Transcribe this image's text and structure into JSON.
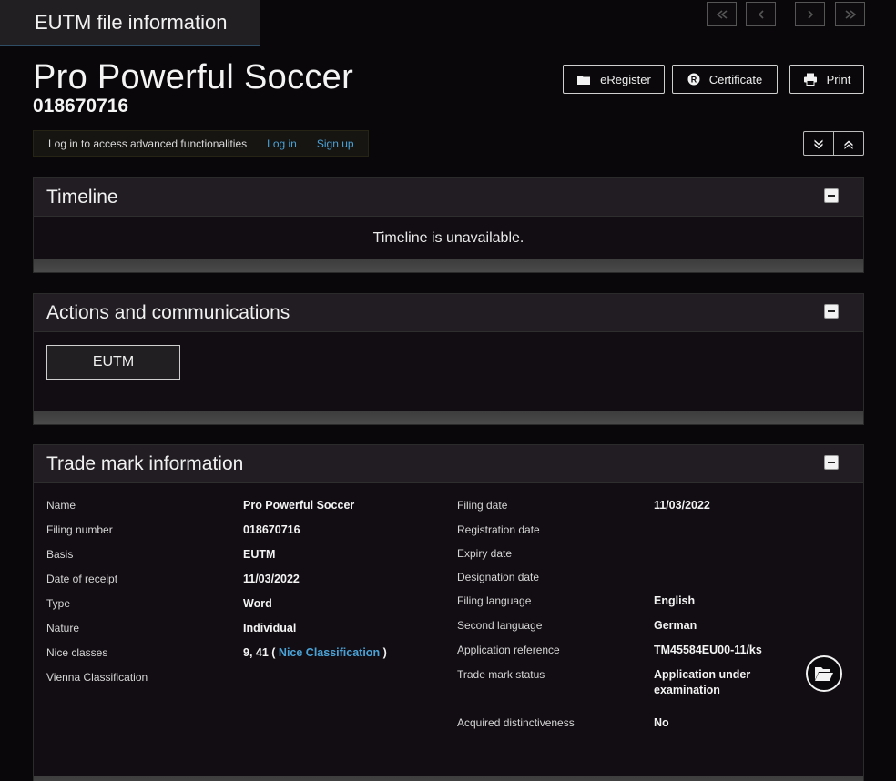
{
  "header": {
    "tab_title": "EUTM file information"
  },
  "trademark": {
    "title": "Pro Powerful Soccer",
    "file_number": "018670716"
  },
  "toolbar": {
    "eregister_label": "eRegister",
    "certificate_label": "Certificate",
    "print_label": "Print"
  },
  "login": {
    "message": "Log in to access advanced functionalities",
    "login_link": "Log in",
    "signup_link": "Sign up"
  },
  "timeline": {
    "heading": "Timeline",
    "message": "Timeline is unavailable."
  },
  "actions": {
    "heading": "Actions and communications",
    "eutm_button": "EUTM"
  },
  "info": {
    "heading": "Trade mark information",
    "left": [
      {
        "label": "Name",
        "value": "Pro Powerful Soccer"
      },
      {
        "label": "Filing number",
        "value": "018670716"
      },
      {
        "label": "Basis",
        "value": "EUTM"
      },
      {
        "label": "Date of receipt",
        "value": "11/03/2022"
      },
      {
        "label": "Type",
        "value": "Word"
      },
      {
        "label": "Nature",
        "value": "Individual"
      },
      {
        "label": "Nice classes",
        "value": "9, 41 (",
        "link": "Nice Classification",
        "suffix": ")"
      },
      {
        "label": "Vienna Classification",
        "value": ""
      }
    ],
    "right": [
      {
        "label": "Filing date",
        "value": "11/03/2022"
      },
      {
        "label": "Registration date",
        "value": ""
      },
      {
        "label": "Expiry date",
        "value": ""
      },
      {
        "label": "Designation date",
        "value": ""
      },
      {
        "label": "Filing language",
        "value": "English"
      },
      {
        "label": "Second language",
        "value": "German"
      },
      {
        "label": "Application reference",
        "value": "TM45584EU00-11/ks"
      },
      {
        "label": "Trade mark status",
        "value": "Application under",
        "value2": "examination"
      },
      {
        "label": "Acquired distinctiveness",
        "value": "No"
      }
    ]
  },
  "colors": {
    "link": "#4aa3d8",
    "header_accent": "#2f4e66",
    "background": "#09070a"
  }
}
